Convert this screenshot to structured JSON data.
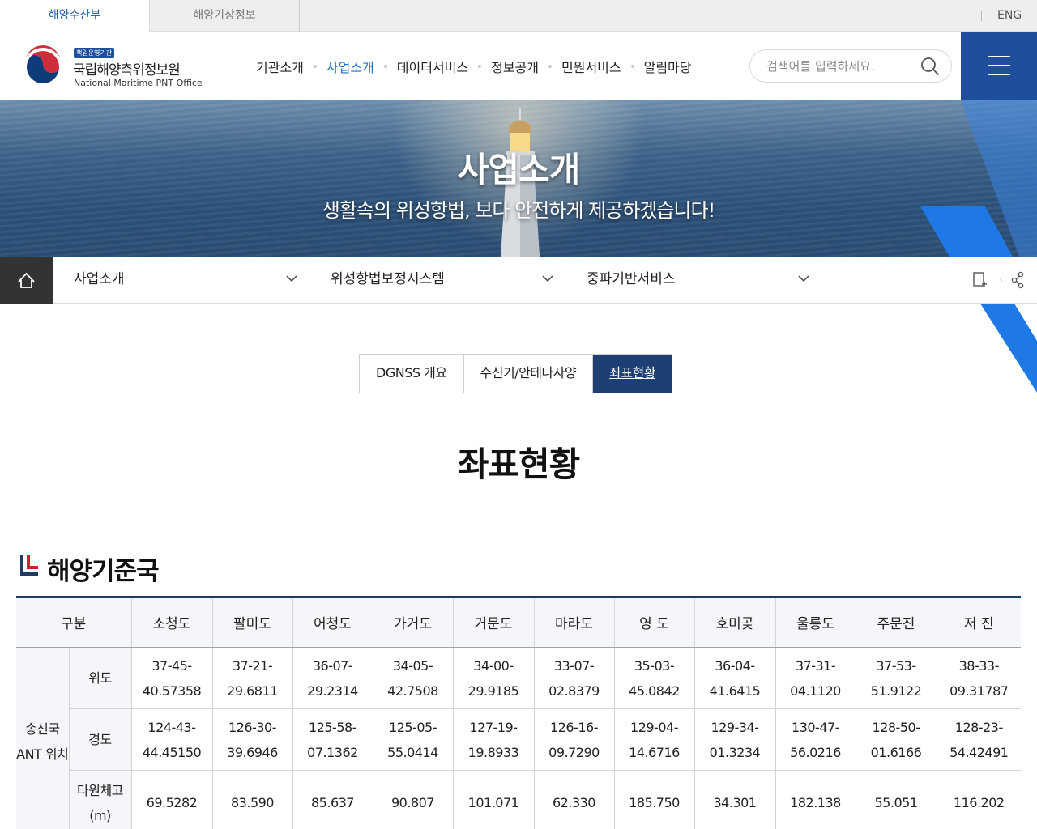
{
  "topbar": {
    "tabs": [
      {
        "label": "해양수산부"
      },
      {
        "label": "해양기상정보"
      }
    ],
    "lang": "ENG"
  },
  "header": {
    "badge": "책임운영기관",
    "org_name_ko": "국립해양측위정보원",
    "org_name_en": "National Maritime PNT Office",
    "nav": [
      {
        "label": "기관소개"
      },
      {
        "label": "사업소개"
      },
      {
        "label": "데이터서비스"
      },
      {
        "label": "정보공개"
      },
      {
        "label": "민원서비스"
      },
      {
        "label": "알림마당"
      }
    ],
    "search_placeholder": "검색어를 입력하세요."
  },
  "hero": {
    "title": "사업소개",
    "subtitle": "생활속의 위성항법, 보다 안전하게 제공하겠습니다!"
  },
  "location": {
    "level1": "사업소개",
    "level2": "위성항법보정시스템",
    "level3": "중파기반서비스"
  },
  "subtabs": [
    {
      "label": "DGNSS 개요"
    },
    {
      "label": "수신기/안테나사양"
    },
    {
      "label": "좌표현황"
    }
  ],
  "page_title": "좌표현황",
  "section_title": "해양기준국",
  "table": {
    "header_first": "구분",
    "stations": [
      "소청도",
      "팔미도",
      "어청도",
      "가거도",
      "거문도",
      "마라도",
      "영 도",
      "호미곶",
      "울릉도",
      "주문진",
      "저 진"
    ],
    "group_label": "송신국 ANT 위치",
    "rows": [
      {
        "label": "위도",
        "values": [
          [
            "37-45-",
            "40.57358"
          ],
          [
            "37-21-",
            "29.6811"
          ],
          [
            "36-07-",
            "29.2314"
          ],
          [
            "34-05-",
            "42.7508"
          ],
          [
            "34-00-",
            "29.9185"
          ],
          [
            "33-07-",
            "02.8379"
          ],
          [
            "35-03-",
            "45.0842"
          ],
          [
            "36-04-",
            "41.6415"
          ],
          [
            "37-31-",
            "04.1120"
          ],
          [
            "37-53-",
            "51.9122"
          ],
          [
            "38-33-",
            "09.31787"
          ]
        ]
      },
      {
        "label": "경도",
        "values": [
          [
            "124-43-",
            "44.45150"
          ],
          [
            "126-30-",
            "39.6946"
          ],
          [
            "125-58-",
            "07.1362"
          ],
          [
            "125-05-",
            "55.0414"
          ],
          [
            "127-19-",
            "19.8933"
          ],
          [
            "126-16-",
            "09.7290"
          ],
          [
            "129-04-",
            "14.6716"
          ],
          [
            "129-34-",
            "01.3234"
          ],
          [
            "130-47-",
            "56.0216"
          ],
          [
            "128-50-",
            "01.6166"
          ],
          [
            "128-23-",
            "54.42491"
          ]
        ]
      },
      {
        "label": "타원체고(m)",
        "values": [
          [
            "69.5282"
          ],
          [
            "83.590"
          ],
          [
            "85.637"
          ],
          [
            "90.807"
          ],
          [
            "101.071"
          ],
          [
            "62.330"
          ],
          [
            "185.750"
          ],
          [
            "34.301"
          ],
          [
            "182.138"
          ],
          [
            "55.051"
          ],
          [
            "116.202"
          ]
        ]
      }
    ]
  },
  "colors": {
    "brand_blue": "#1f4f9c",
    "active_tab": "#1e3f74",
    "nav_active": "#1f6fc4"
  }
}
